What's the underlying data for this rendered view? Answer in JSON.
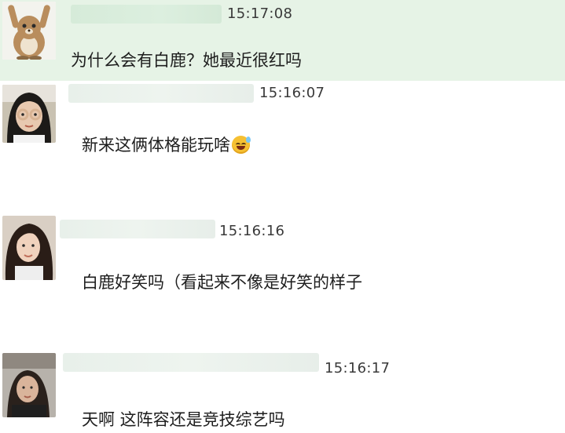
{
  "messages": [
    {
      "time": "15:17:08",
      "text": "为什么会有白鹿？她最近很红吗",
      "avatar": "cartoon-bear-avatar",
      "emoji": ""
    },
    {
      "time": "15:16:07",
      "text": "新来这俩体格能玩啥",
      "avatar": "user-photo-avatar",
      "emoji": "sweat-smile-emoji"
    },
    {
      "time": "15:16:16",
      "text": "白鹿好笑吗（看起来不像是好笑的样子",
      "avatar": "user-photo-avatar",
      "emoji": ""
    },
    {
      "time": "15:16:17",
      "text": "天啊 这阵容还是竞技综艺吗",
      "avatar": "user-photo-avatar",
      "emoji": ""
    }
  ],
  "colors": {
    "highlight_bg": "#e6f3e6",
    "text": "#1e1e1e",
    "time": "#3a3a3a"
  }
}
